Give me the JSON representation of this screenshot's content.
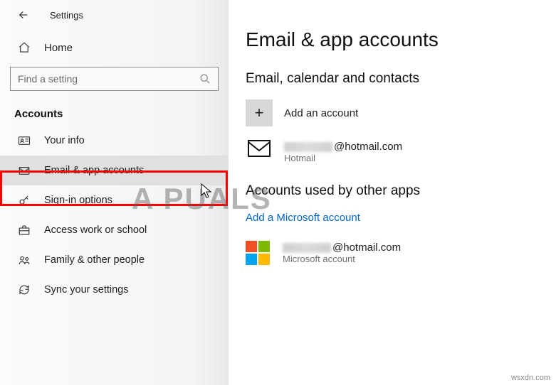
{
  "window": {
    "title": "Settings"
  },
  "sidebar": {
    "home_label": "Home",
    "search_placeholder": "Find a setting",
    "category": "Accounts",
    "items": [
      {
        "label": "Your info"
      },
      {
        "label": "Email & app accounts"
      },
      {
        "label": "Sign-in options"
      },
      {
        "label": "Access work or school"
      },
      {
        "label": "Family & other people"
      },
      {
        "label": "Sync your settings"
      }
    ]
  },
  "main": {
    "title": "Email & app accounts",
    "section1_title": "Email, calendar and contacts",
    "add_account_label": "Add an account",
    "account1_email_suffix": "@hotmail.com",
    "account1_sub": "Hotmail",
    "section2_title": "Accounts used by other apps",
    "add_ms_link": "Add a Microsoft account",
    "account2_email_suffix": "@hotmail.com",
    "account2_sub": "Microsoft account"
  },
  "watermark": "A   PUALS",
  "footer": "wsxdn.com"
}
